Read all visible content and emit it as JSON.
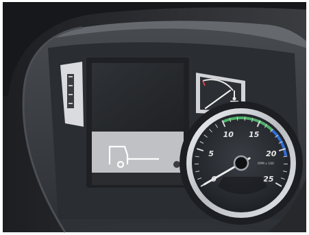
{
  "dashboard": {
    "tachometer": {
      "scale_labels": [
        "0",
        "5",
        "10",
        "15",
        "20",
        "25"
      ],
      "unit_text": "RPM x 100",
      "needle_value": 0,
      "green_band": [
        10,
        17
      ],
      "blue_band": [
        17,
        21
      ]
    },
    "display": {
      "screen_state": "off",
      "icon": "truck-tractor-icon"
    },
    "temperature_gauge": {
      "icon": "coolant-temperature-icon",
      "needle_level": 0.55
    },
    "colors": {
      "dial_face": "#2b2e33",
      "chrome_ring": "#c9ccd0",
      "green_band": "#4fb36b",
      "blue_band": "#2f6fd6",
      "needle": "#e9e9e9",
      "dashboard_plastic": "#3a3d42"
    }
  }
}
